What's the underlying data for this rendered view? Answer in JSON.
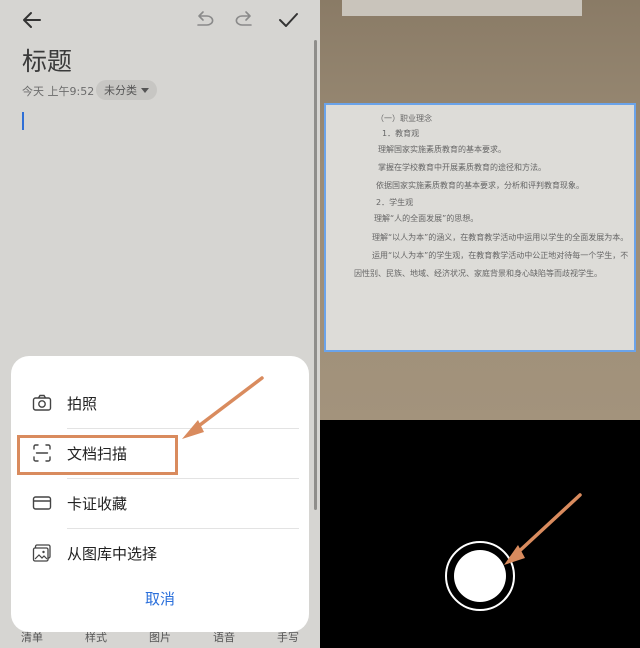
{
  "note": {
    "title": "标题",
    "date": "今天 上午9:52",
    "category": "未分类"
  },
  "sheet": {
    "options": [
      {
        "label": "拍照",
        "icon": "camera-icon"
      },
      {
        "label": "文档扫描",
        "icon": "scan-icon"
      },
      {
        "label": "卡证收藏",
        "icon": "card-icon"
      },
      {
        "label": "从图库中选择",
        "icon": "gallery-icon"
      }
    ],
    "cancel": "取消"
  },
  "bottom_bar": [
    "清单",
    "样式",
    "图片",
    "语音",
    "手写"
  ],
  "document": {
    "lines": [
      "（一）职业理念",
      "1．教育观",
      "理解国家实施素质教育的基本要求。",
      "掌握在学校教育中开展素质教育的途径和方法。",
      "依据国家实施素质教育的基本要求，分析和评判教育现象。",
      "2．学生观",
      "理解“人的全面发展”的思想。",
      "理解“以人为本”的涵义，在教育教学活动中运用以学生的全面发展为本。",
      "运用“以人为本”的学生观，在教育教学活动中公正地对待每一个学生，不",
      "因性别、民族、地域、经济状况、家庭背景和身心缺陷等而歧视学生。"
    ]
  },
  "colors": {
    "accent": "#2a6fdb",
    "annotation": "#d98b5e",
    "scan_frame": "#6aa3ea"
  }
}
